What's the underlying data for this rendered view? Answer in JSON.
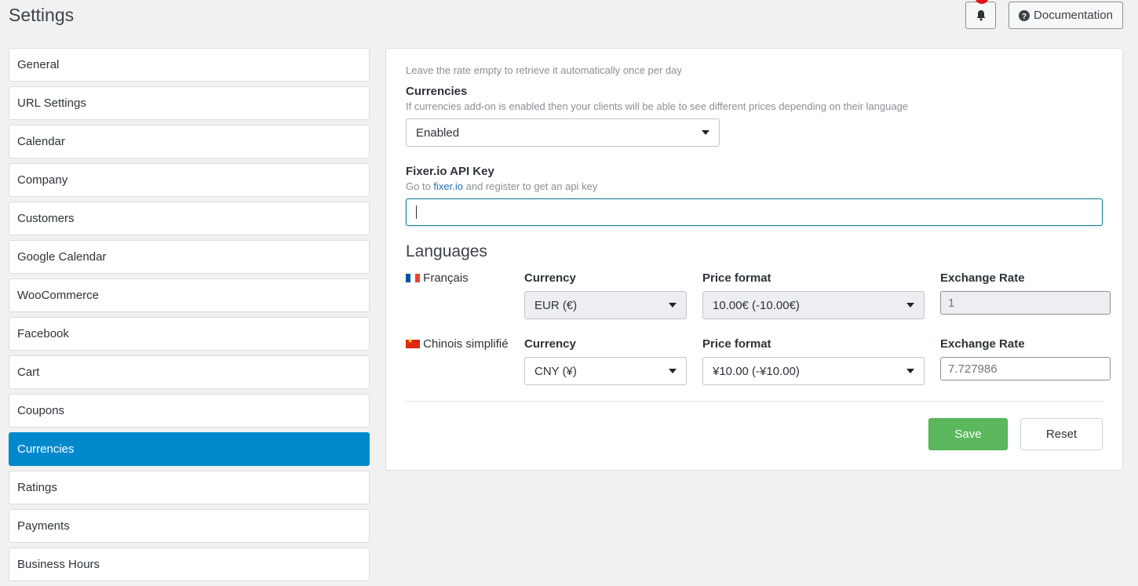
{
  "header": {
    "title": "Settings",
    "documentation_label": "Documentation"
  },
  "sidebar": {
    "items": [
      {
        "label": "General"
      },
      {
        "label": "URL Settings"
      },
      {
        "label": "Calendar"
      },
      {
        "label": "Company"
      },
      {
        "label": "Customers"
      },
      {
        "label": "Google Calendar"
      },
      {
        "label": "WooCommerce"
      },
      {
        "label": "Facebook"
      },
      {
        "label": "Cart"
      },
      {
        "label": "Coupons"
      },
      {
        "label": "Currencies",
        "active": true
      },
      {
        "label": "Ratings"
      },
      {
        "label": "Payments"
      },
      {
        "label": "Business Hours"
      }
    ]
  },
  "panel": {
    "rate_hint": "Leave the rate empty to retrieve it automatically once per day",
    "currencies": {
      "label": "Currencies",
      "hint": "If currencies add-on is enabled then your clients will be able to see different prices depending on their language",
      "value": "Enabled"
    },
    "fixer": {
      "label": "Fixer.io API Key",
      "hint_before": "Go to",
      "link_text": "fixer.io",
      "hint_after": "and register to get an api key",
      "value": ""
    },
    "languages_heading": "Languages",
    "languages": [
      {
        "name": "Français",
        "flag": "flag-fr",
        "currency_label": "Currency",
        "currency_value": "EUR (€)",
        "price_format_label": "Price format",
        "price_format_value": "10.00€ (-10.00€)",
        "rate_label": "Exchange Rate",
        "rate_placeholder": "1",
        "rate_disabled": true
      },
      {
        "name": "Chinois simplifié",
        "flag": "flag-cn",
        "currency_label": "Currency",
        "currency_value": "CNY (¥)",
        "price_format_label": "Price format",
        "price_format_value": "¥10.00 (-¥10.00)",
        "rate_label": "Exchange Rate",
        "rate_placeholder": "7.727986",
        "rate_disabled": false
      }
    ],
    "save_label": "Save",
    "reset_label": "Reset"
  },
  "colors": {
    "accent": "#0088cc",
    "save": "#5cb85c",
    "badge": "#e4131b"
  }
}
